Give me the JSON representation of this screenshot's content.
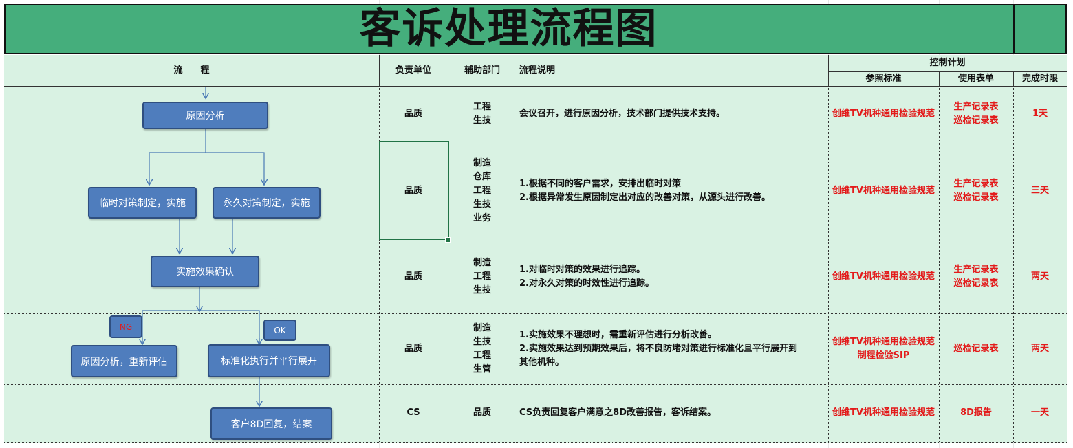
{
  "title": "客诉处理流程图",
  "headers": {
    "flow": "流　　程",
    "owner": "负责单位",
    "assist": "辅助部门",
    "desc": "流程说明",
    "control": "控制计划",
    "standard": "参照标准",
    "form": "使用表单",
    "deadline": "完成时限"
  },
  "rows": [
    {
      "owner": "品质",
      "assist": [
        "工程",
        "生技"
      ],
      "desc": [
        "会议召开，进行原因分析，技术部门提供技术支持。"
      ],
      "standard": [
        "创维TV机种通用检验规范"
      ],
      "form": [
        "生产记录表",
        "巡检记录表"
      ],
      "deadline": "1天"
    },
    {
      "owner": "品质",
      "assist": [
        "制造",
        "仓库",
        "工程",
        "生技",
        "业务"
      ],
      "desc": [
        "1.根据不同的客户需求，安排出临时对策",
        "2.根据异常发生原因制定出对应的改善对策，从源头进行改善。"
      ],
      "standard": [
        "创维TV机种通用检验规范"
      ],
      "form": [
        "生产记录表",
        "巡检记录表"
      ],
      "deadline": "三天"
    },
    {
      "owner": "品质",
      "assist": [
        "制造",
        "工程",
        "生技"
      ],
      "desc": [
        "1.对临时对策的效果进行追踪。",
        "2.对永久对策的时效性进行追踪。"
      ],
      "standard": [
        "创维TV机种通用检验规范"
      ],
      "form": [
        "生产记录表",
        "巡检记录表"
      ],
      "deadline": "两天"
    },
    {
      "owner": "品质",
      "assist": [
        "制造",
        "生技",
        "工程",
        "生管"
      ],
      "desc": [
        "1.实施效果不理想时，需重新评估进行分析改善。",
        "2.实施效果达到预期效果后，将不良防堵对策进行标准化且平行展开到",
        "其他机种。"
      ],
      "standard": [
        "创维TV机种通用检验规范",
        "制程检验SIP"
      ],
      "form": [
        "巡检记录表"
      ],
      "deadline": "两天"
    },
    {
      "owner": "CS",
      "assist": [
        "品质"
      ],
      "desc": [
        "CS负责回复客户满意之8D改善报告，客诉结案。"
      ],
      "standard": [
        "创维TV机种通用检验规范"
      ],
      "form": [
        "8D报告"
      ],
      "deadline": "一天"
    }
  ],
  "flow": {
    "cause_analysis": "原因分析",
    "temp_measure": "临时对策制定，实施",
    "perm_measure": "永久对策制定，实施",
    "effect_confirm": "实施效果确认",
    "ng": "NG",
    "ok": "OK",
    "reanalyze": "原因分析，重新评估",
    "standardize": "标准化执行并平行展开",
    "close": "客户8D回复，结案"
  },
  "colors": {
    "title_bg": "#45ae7c",
    "table_bg": "#d9f2e3",
    "box_fill": "#4f7dbd",
    "red_text": "#e31b1b"
  }
}
